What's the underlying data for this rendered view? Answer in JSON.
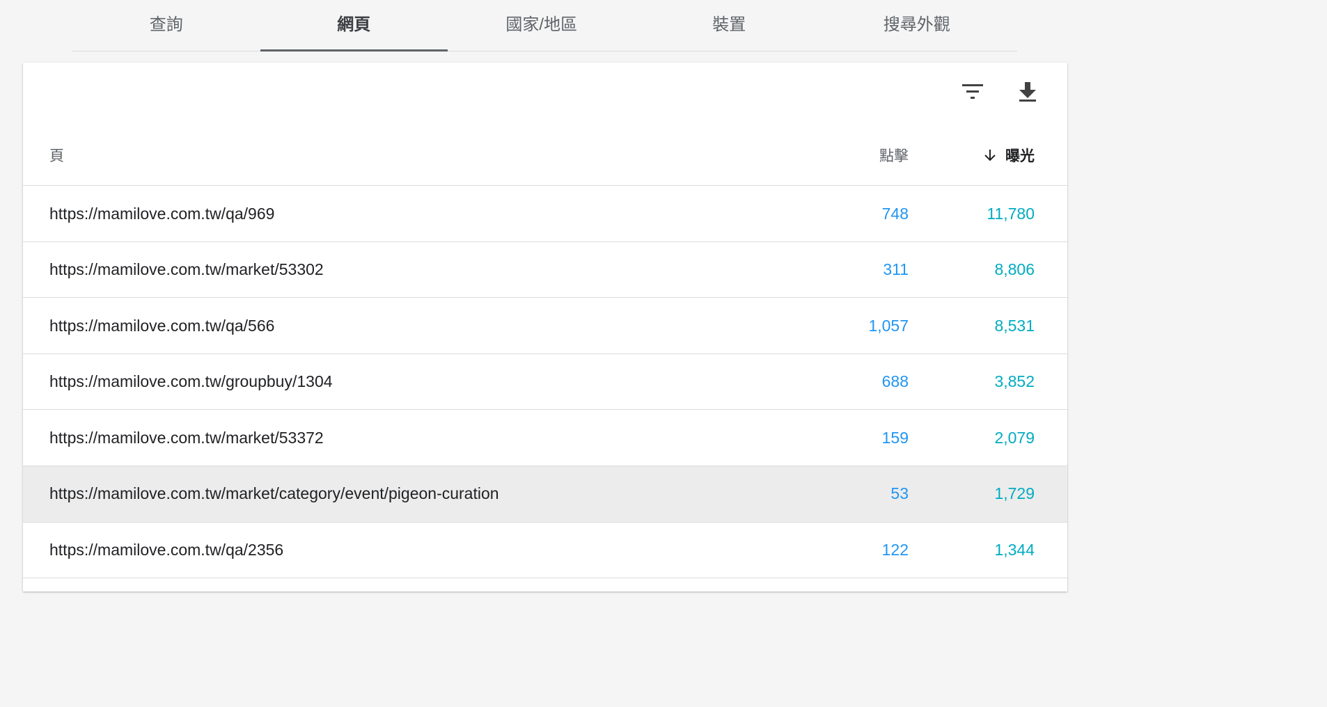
{
  "tabs": [
    {
      "label": "查詢",
      "active": false
    },
    {
      "label": "網頁",
      "active": true
    },
    {
      "label": "國家/地區",
      "active": false
    },
    {
      "label": "裝置",
      "active": false
    },
    {
      "label": "搜尋外觀",
      "active": false
    }
  ],
  "toolbar": {
    "filter_icon": "filter-icon",
    "download_icon": "download-icon"
  },
  "table": {
    "columns": {
      "page": "頁",
      "clicks": "點擊",
      "impressions": "曝光",
      "sort_icon": "arrow-down-icon",
      "sort_column": "impressions",
      "sort_direction": "desc"
    },
    "rows": [
      {
        "url": "https://mamilove.com.tw/qa/969",
        "clicks": "748",
        "impressions": "11,780"
      },
      {
        "url": "https://mamilove.com.tw/market/53302",
        "clicks": "311",
        "impressions": "8,806"
      },
      {
        "url": "https://mamilove.com.tw/qa/566",
        "clicks": "1,057",
        "impressions": "8,531"
      },
      {
        "url": "https://mamilove.com.tw/groupbuy/1304",
        "clicks": "688",
        "impressions": "3,852"
      },
      {
        "url": "https://mamilove.com.tw/market/53372",
        "clicks": "159",
        "impressions": "2,079"
      },
      {
        "url": "https://mamilove.com.tw/market/category/event/pigeon-curation",
        "clicks": "53",
        "impressions": "1,729",
        "hovered": true
      },
      {
        "url": "https://mamilove.com.tw/qa/2356",
        "clicks": "122",
        "impressions": "1,344"
      }
    ]
  },
  "colors": {
    "clicks": "#2196f3",
    "impressions": "#00acc1",
    "hover_row": "#ececec"
  }
}
